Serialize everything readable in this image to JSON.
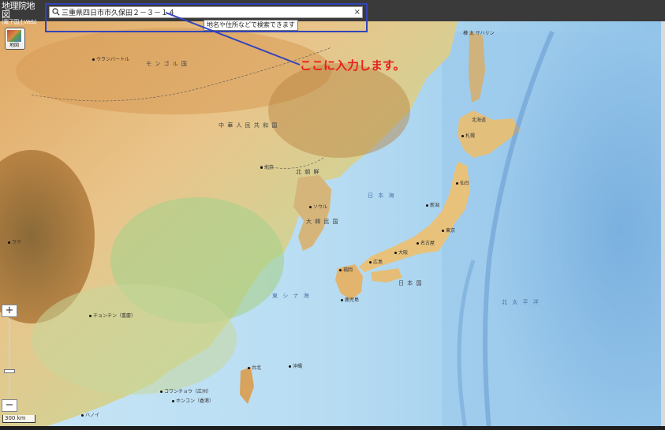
{
  "brand": {
    "title": "地理院地図",
    "subtitle": "(電子国土Web)"
  },
  "search": {
    "value": "三重県四日市市久保田２－３－１４",
    "placeholder": "地名や住所などで検索できます",
    "hint": "地名や住所などで検索できます",
    "clear_label": "×"
  },
  "callout": {
    "text": "ここに入力します。",
    "color": "#e8201c"
  },
  "map_type_button": {
    "label": "地図"
  },
  "zoom": {
    "in_label": "+",
    "out_label": "−"
  },
  "scale": {
    "label": "300 km"
  },
  "colors": {
    "highlight": "#3344bb",
    "sea": "#b7dcf2",
    "topbar": "#3a3a3a"
  },
  "labels": {
    "mongolia": "モ ン ゴ ル 国",
    "ulaanbaatar": "ウランバートル",
    "china": "中 華 人 民 共 和 国",
    "north_korea": "北 朝 鮮",
    "south_korea": "大 韓 民 国",
    "sea_of_japan": "日 本 海",
    "east_china_sea": "東 シ ナ 海",
    "pacific": "北 太 平 洋",
    "japan": "日 本 国",
    "sakhalin": "樺 太 サハリン",
    "hokkaido": "北海道",
    "sapporo": "札幌",
    "sendai": "仙台",
    "niigata": "新潟",
    "tokyo": "東京",
    "nagoya": "名古屋",
    "osaka": "大阪",
    "hiroshima": "広島",
    "fukuoka": "福岡",
    "kagoshima": "鹿児島",
    "okinawa": "沖縄",
    "taipei": "台北",
    "lhasa": "ラサ",
    "chongqing": "チョンチン（重慶）",
    "guangzhou": "コワンチョウ（広州）",
    "hongkong": "ホンコン（香港）",
    "hanoi": "ハノイ",
    "beijing": "北京",
    "seoul": "ソウル"
  }
}
